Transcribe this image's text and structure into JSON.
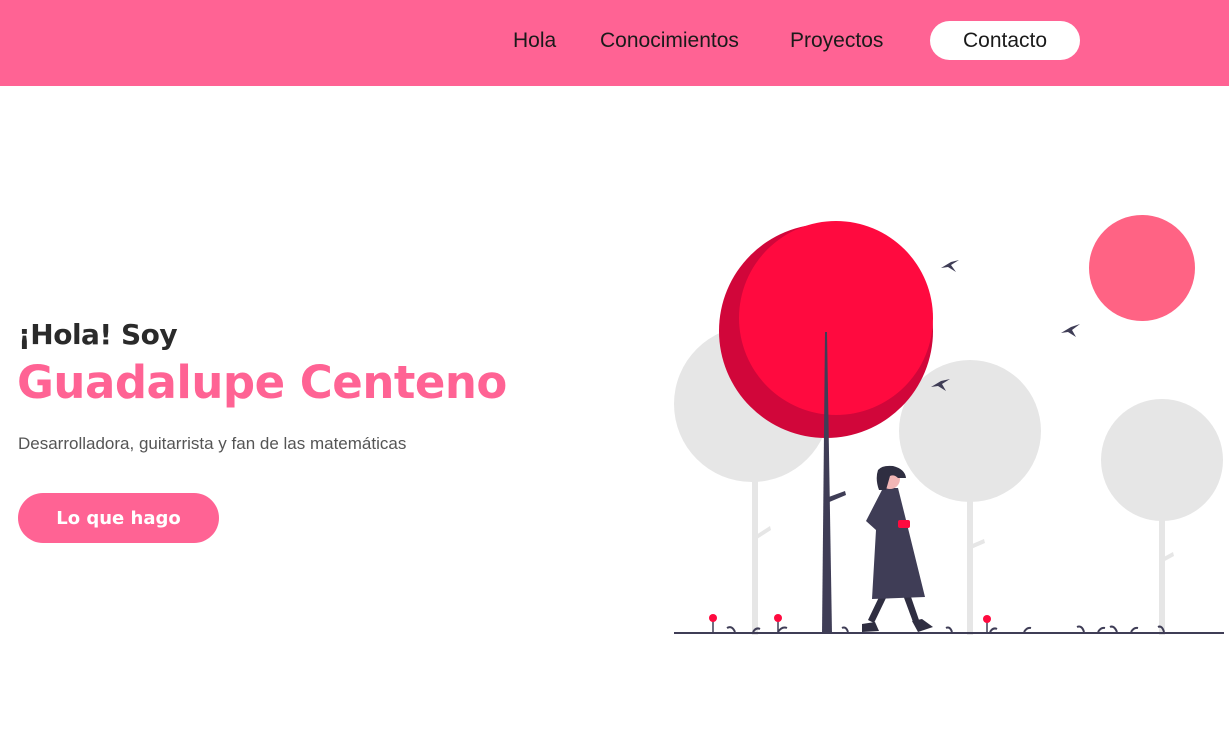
{
  "nav": {
    "items": [
      {
        "label": "Hola"
      },
      {
        "label": "Conocimientos"
      },
      {
        "label": "Proyectos"
      }
    ],
    "contact_label": "Contacto"
  },
  "hero": {
    "greeting": "¡Hola! Soy",
    "name": "Guadalupe Centeno",
    "tagline": "Desarrolladora, guitarrista y fan de las matemáticas",
    "cta_label": "Lo que hago"
  },
  "colors": {
    "brand_pink": "#ff6394",
    "tree_red": "#ff0a3f",
    "tree_red_shadow": "#d1063a",
    "gray_tree": "#e6e6e6",
    "figure_dark": "#3f3d56"
  }
}
